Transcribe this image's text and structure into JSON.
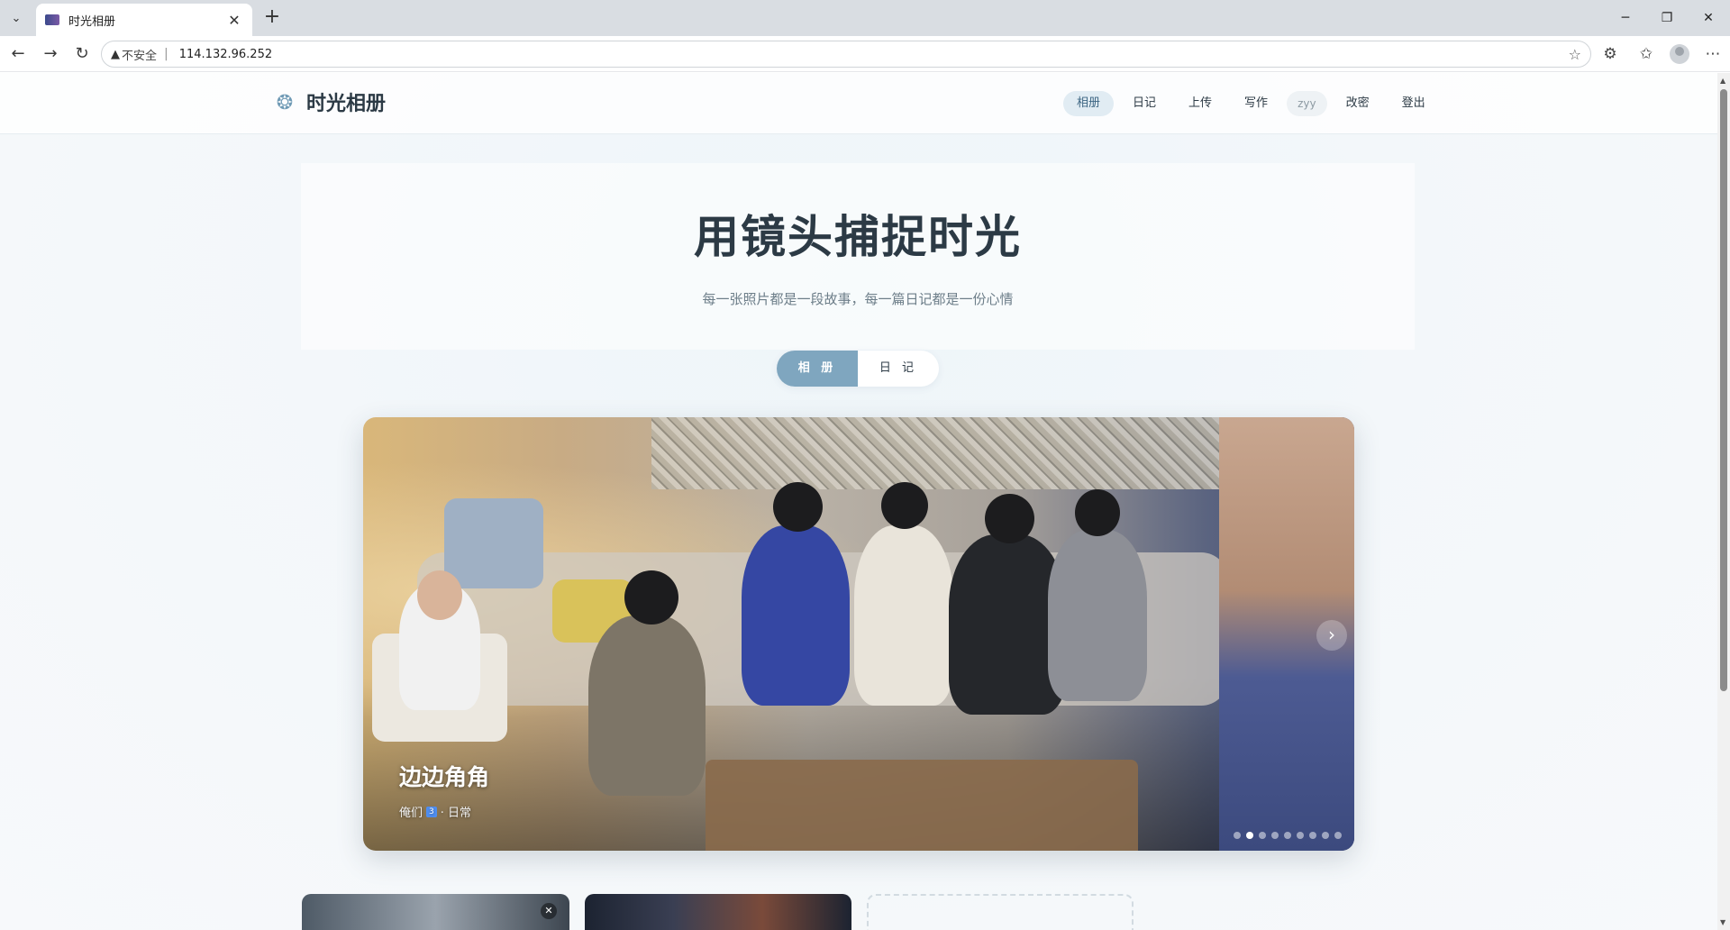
{
  "browser": {
    "tab_title": "时光相册",
    "security_label": "不安全",
    "url": "114.132.96.252"
  },
  "header": {
    "logo_text": "时光相册",
    "nav": [
      "相册",
      "日记",
      "上传",
      "写作",
      "zyy",
      "改密",
      "登出"
    ],
    "active_nav": "相册"
  },
  "hero": {
    "title": "用镜头捕捉时光",
    "subtitle": "每一张照片都是一段故事，每一篇日记都是一份心情"
  },
  "switch": {
    "album": "相 册",
    "diary": "日 记",
    "active": "album"
  },
  "carousel": {
    "title": "边边角角",
    "meta_prefix": "俺们",
    "meta_badge": "3",
    "meta_suffix": "· 日常",
    "slide_count": 9,
    "active_slide": 2
  },
  "colors": {
    "accent": "#7fa6bf",
    "text": "#2c3a45",
    "nav_active_bg": "#e1ecf3"
  },
  "icons": {
    "logo": "gear-flower-icon",
    "next": "chevron-right-icon",
    "card_close": "close-icon"
  }
}
